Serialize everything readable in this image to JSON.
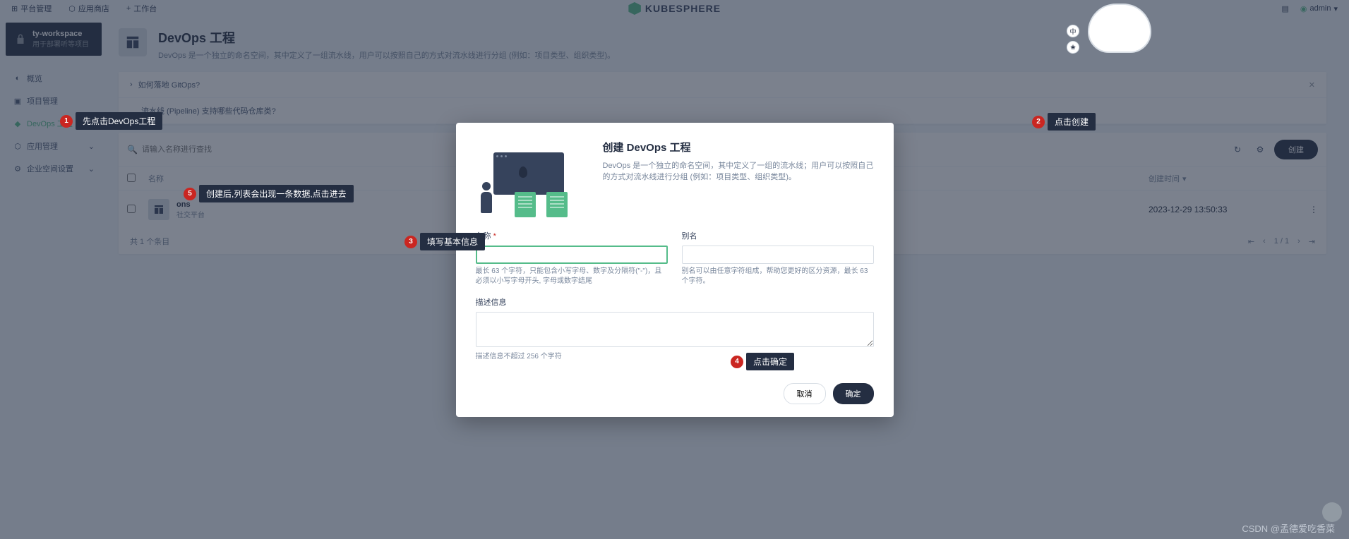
{
  "topbar": {
    "platform": "平台管理",
    "app_store": "应用商店",
    "workbench": "工作台",
    "brand": "KUBESPHERE",
    "user": "admin"
  },
  "workspace": {
    "name": "ty-workspace",
    "desc": "用于部署听等项目"
  },
  "nav": {
    "overview": "概览",
    "projects": "项目管理",
    "devops": "DevOps 工程",
    "apps": "应用管理",
    "settings": "企业空间设置"
  },
  "page": {
    "title": "DevOps 工程",
    "desc": "DevOps 是一个独立的命名空间，其中定义了一组流水线，用户可以按照自己的方式对流水线进行分组 (例如：项目类型、组织类型)。"
  },
  "faq": {
    "q1": "如何落地 GitOps?",
    "q2": "流水线 (Pipeline) 支持哪些代码仓库类?"
  },
  "toolbar": {
    "search_placeholder": "请输入名称进行查找",
    "create": "创建"
  },
  "table": {
    "col_name": "名称",
    "col_time": "创建时间",
    "row1_name": "ons",
    "row1_sub": "社交平台",
    "row1_time": "2023-12-29 13:50:33",
    "footer": "共 1 个条目",
    "page": "1 / 1"
  },
  "modal": {
    "title": "创建 DevOps 工程",
    "desc": "DevOps 是一个独立的命名空间，其中定义了一组的流水线；用户可以按照自己的方式对流水线进行分组 (例如：项目类型、组织类型)。",
    "name_label": "名称",
    "name_hint": "最长 63 个字符，只能包含小写字母、数字及分隔符(\"-\")，且必须以小写字母开头, 字母或数字结尾",
    "alias_label": "别名",
    "alias_hint": "别名可以由任意字符组成，帮助您更好的区分资源，最长 63 个字符。",
    "desc_label": "描述信息",
    "desc_hint": "描述信息不超过 256 个字符",
    "cancel": "取消",
    "ok": "确定"
  },
  "callouts": {
    "c1": "先点击DevOps工程",
    "c2": "点击创建",
    "c3": "填写基本信息",
    "c4": "点击确定",
    "c5": "创建后,列表会出现一条数据,点击进去"
  },
  "mascot": {
    "b1": "中",
    "b2": "❀"
  },
  "watermark": "CSDN @孟德爱吃香菜"
}
